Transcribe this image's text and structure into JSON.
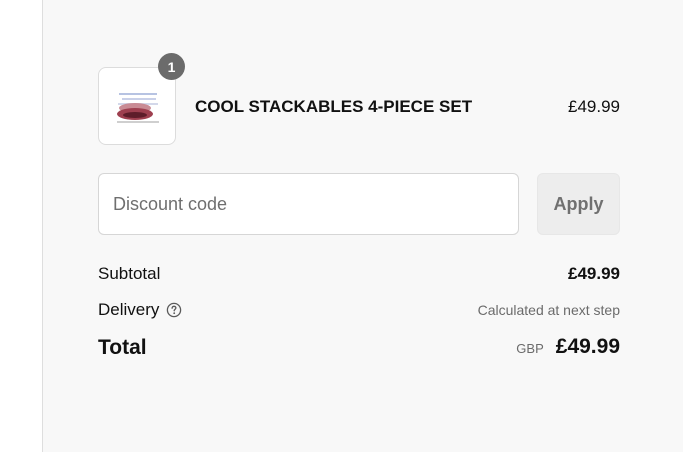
{
  "order_summary": {
    "item": {
      "name": "COOL STACKABLES 4-PIECE SET",
      "price": "£49.99",
      "quantity": "1",
      "thumbnail_icon": "product-thumbnail"
    },
    "discount": {
      "placeholder": "Discount code",
      "value": "",
      "apply_label": "Apply"
    },
    "subtotal": {
      "label": "Subtotal",
      "value": "£49.99"
    },
    "delivery": {
      "label": "Delivery",
      "value": "Calculated at next step",
      "help_icon": "question-circle-icon"
    },
    "total": {
      "label": "Total",
      "currency": "GBP",
      "value": "£49.99"
    }
  },
  "colors": {
    "summary_background": "#f8f8f8",
    "badge": "#6b6b6b",
    "apply_button_background": "#ededed",
    "secondary_text": "#6b6b6b"
  }
}
